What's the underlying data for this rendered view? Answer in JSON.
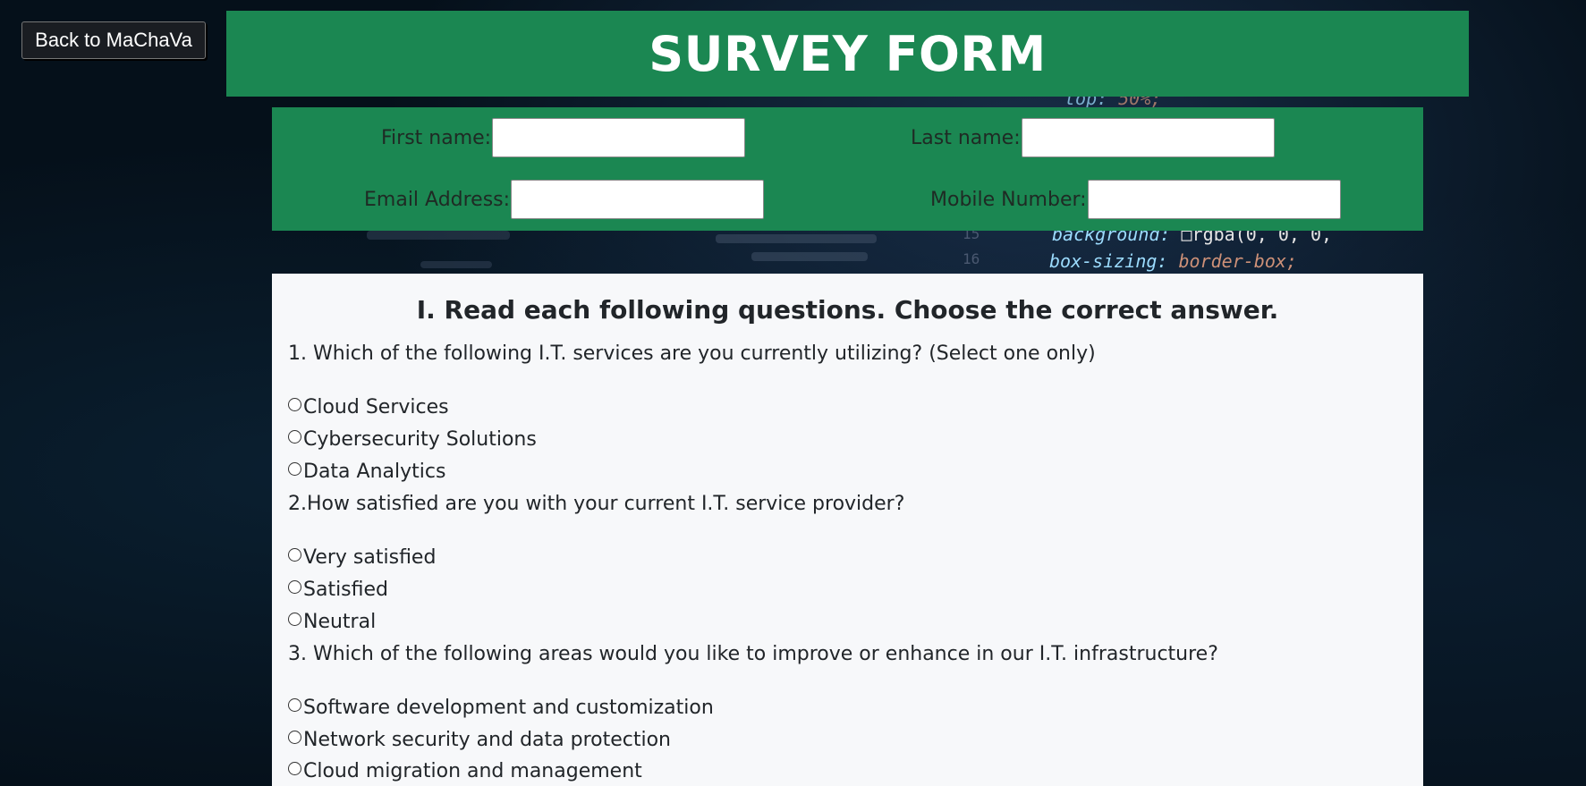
{
  "nav": {
    "back_label": "Back to MaChaVa"
  },
  "header": {
    "title": "SURVEY FORM"
  },
  "info": {
    "first_name_label": "First name:",
    "last_name_label": "Last name:",
    "email_label": "Email Address:",
    "mobile_label": "Mobile Number:",
    "first_name_value": "",
    "last_name_value": "",
    "email_value": "",
    "mobile_value": ""
  },
  "section": {
    "heading": "I. Read each following questions. Choose the correct answer.",
    "questions": [
      {
        "text": "1. Which of the following I.T. services are you currently utilizing? (Select one only)",
        "options": [
          "Cloud Services",
          "Cybersecurity Solutions",
          "Data Analytics"
        ]
      },
      {
        "text": "2.How satisfied are you with your current I.T. service provider?",
        "options": [
          "Very satisfied",
          "Satisfied",
          "Neutral"
        ]
      },
      {
        "text": "3. Which of the following areas would you like to improve or enhance in our I.T. infrastructure?",
        "options": [
          "Software development and customization",
          "Network security and data protection",
          "Cloud migration and management"
        ]
      }
    ]
  },
  "background": {
    "code_lines": [
      {
        "key": "top:",
        "val": " 50%;"
      },
      {
        "key": "background:",
        "val": " □rgba(0, 0, 0,"
      },
      {
        "key": "box-sizing:",
        "val": " border-box;"
      }
    ],
    "line_numbers": [
      "15",
      "16"
    ]
  },
  "colors": {
    "banner_green": "#1b8752",
    "panel_bg": "#f7f8fa",
    "page_bg": "#05101a"
  }
}
